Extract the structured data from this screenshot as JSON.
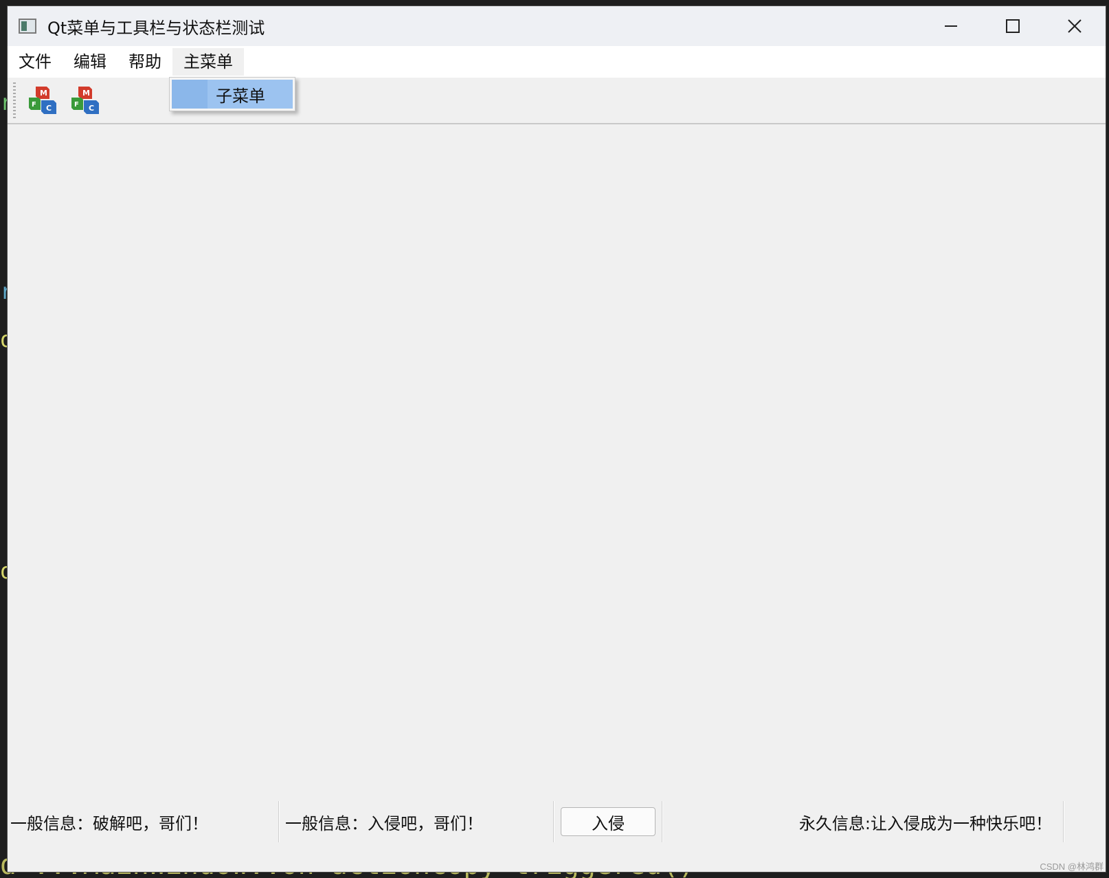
{
  "window": {
    "title": "Qt菜单与工具栏与状态栏测试",
    "controls": {
      "minimize": "—",
      "maximize": "☐",
      "close": "✕"
    }
  },
  "menubar": {
    "items": [
      {
        "label": "文件"
      },
      {
        "label": "编辑"
      },
      {
        "label": "帮助"
      },
      {
        "label": "主菜单"
      }
    ]
  },
  "dropdown": {
    "parent": "主菜单",
    "items": [
      {
        "label": "子菜单"
      }
    ]
  },
  "toolbar": {
    "buttons": [
      {
        "icon": "mfc-icon"
      },
      {
        "icon": "mfc-icon"
      }
    ]
  },
  "statusbar": {
    "message1": "一般信息：破解吧，哥们！",
    "message2": "一般信息：入侵吧，哥们！",
    "button_label": "入侵",
    "permanent": "永久信息:让入侵成为一种快乐吧！"
  },
  "background": {
    "code_line": "d  ...MainWindow::on_actionCopy_triggered()",
    "watermark": "CSDN @林鸿群"
  },
  "colors": {
    "menu_highlight": "#9cc3f0",
    "titlebar": "#eef0f4",
    "window_bg": "#f0f0f0"
  }
}
